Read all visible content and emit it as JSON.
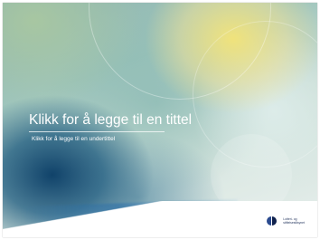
{
  "slide": {
    "title": "Klikk for å legge til en tittel",
    "subtitle": "Klikk for å legge til en undertittel",
    "logo": {
      "line1": "Lotteri- og",
      "line2": "stiftelsestilsynet",
      "icon": "lotteritilsynet-logo-icon",
      "colors": {
        "left": "#2a4a8f",
        "right": "#10224e"
      }
    }
  },
  "colors": {
    "title_text": "#ffffff",
    "accent_dark_blue": "#063a64",
    "accent_yellow": "#f4e478"
  }
}
